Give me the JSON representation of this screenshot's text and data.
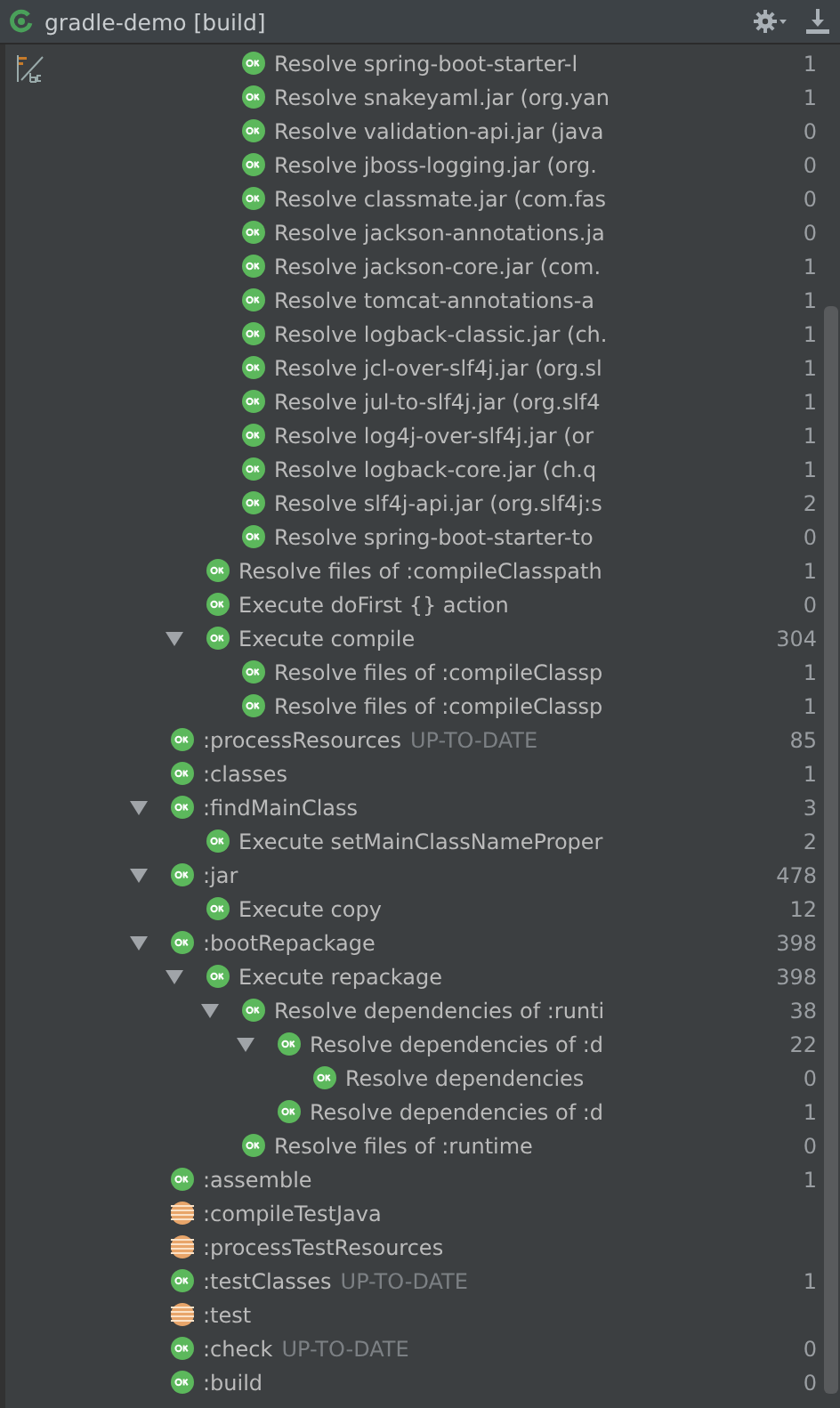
{
  "window": {
    "title": "gradle-demo [build]"
  },
  "tree": [
    {
      "children": [
        {
          "children": [
            {
              "label": "Resolve spring-boot-starter-l",
              "kind": "success",
              "time": "1"
            },
            {
              "label": "Resolve snakeyaml.jar (org.yan",
              "kind": "success",
              "time": "1"
            },
            {
              "label": "Resolve validation-api.jar (java",
              "kind": "success",
              "time": "0"
            },
            {
              "label": "Resolve jboss-logging.jar (org.",
              "kind": "success",
              "time": "0"
            },
            {
              "label": "Resolve classmate.jar (com.fas",
              "kind": "success",
              "time": "0"
            },
            {
              "label": "Resolve jackson-annotations.ja",
              "kind": "success",
              "time": "0"
            },
            {
              "label": "Resolve jackson-core.jar (com.",
              "kind": "success",
              "time": "1"
            },
            {
              "label": "Resolve tomcat-annotations-a",
              "kind": "success",
              "time": "1"
            },
            {
              "label": "Resolve logback-classic.jar (ch.",
              "kind": "success",
              "time": "1"
            },
            {
              "label": "Resolve jcl-over-slf4j.jar (org.sl",
              "kind": "success",
              "time": "1"
            },
            {
              "label": "Resolve jul-to-slf4j.jar (org.slf4",
              "kind": "success",
              "time": "1"
            },
            {
              "label": "Resolve log4j-over-slf4j.jar (or",
              "kind": "success",
              "time": "1"
            },
            {
              "label": "Resolve logback-core.jar (ch.q",
              "kind": "success",
              "time": "1"
            },
            {
              "label": "Resolve slf4j-api.jar (org.slf4j:s",
              "kind": "success",
              "time": "2"
            },
            {
              "label": "Resolve spring-boot-starter-to",
              "kind": "success",
              "time": "0"
            }
          ]
        },
        {
          "label": "Resolve files of :compileClasspath",
          "kind": "success",
          "time": "1"
        },
        {
          "label": "Execute doFirst {} action",
          "kind": "success",
          "time": "0"
        },
        {
          "label": "Execute compile",
          "kind": "success",
          "time": "304",
          "expanded": true,
          "children": [
            {
              "label": "Resolve files of :compileClassp",
              "kind": "success",
              "time": "1"
            },
            {
              "label": "Resolve files of :compileClassp",
              "kind": "success",
              "time": "1"
            }
          ]
        }
      ]
    },
    {
      "label": ":processResources",
      "note": "UP-TO-DATE",
      "kind": "success",
      "time": "85"
    },
    {
      "label": ":classes",
      "kind": "success",
      "time": "1"
    },
    {
      "label": ":findMainClass",
      "kind": "success",
      "time": "3",
      "expanded": true,
      "children": [
        {
          "label": "Execute setMainClassNameProper",
          "kind": "success",
          "time": "2"
        }
      ]
    },
    {
      "label": ":jar",
      "kind": "success",
      "time": "478",
      "expanded": true,
      "children": [
        {
          "label": "Execute copy",
          "kind": "success",
          "time": "12"
        }
      ]
    },
    {
      "label": ":bootRepackage",
      "kind": "success",
      "time": "398",
      "expanded": true,
      "children": [
        {
          "label": "Execute repackage",
          "kind": "success",
          "time": "398",
          "expanded": true,
          "children": [
            {
              "label": "Resolve dependencies of :runti",
              "kind": "success",
              "time": "38",
              "expanded": true,
              "children": [
                {
                  "label": "Resolve dependencies of :d",
                  "kind": "success",
                  "time": "22",
                  "expanded": true,
                  "children": [
                    {
                      "label": "Resolve dependencies",
                      "kind": "success",
                      "time": "0"
                    }
                  ]
                },
                {
                  "label": "Resolve dependencies of :d",
                  "kind": "success",
                  "time": "1"
                }
              ]
            },
            {
              "label": "Resolve files of :runtime",
              "kind": "success",
              "time": "0"
            }
          ]
        }
      ]
    },
    {
      "label": ":assemble",
      "kind": "success",
      "time": "1"
    },
    {
      "label": ":compileTestJava",
      "kind": "skipped"
    },
    {
      "label": ":processTestResources",
      "kind": "skipped"
    },
    {
      "label": ":testClasses",
      "note": "UP-TO-DATE",
      "kind": "success",
      "time": "1"
    },
    {
      "label": ":test",
      "kind": "skipped"
    },
    {
      "label": ":check",
      "note": "UP-TO-DATE",
      "kind": "success",
      "time": "0"
    },
    {
      "label": ":build",
      "kind": "success",
      "time": "0"
    }
  ]
}
